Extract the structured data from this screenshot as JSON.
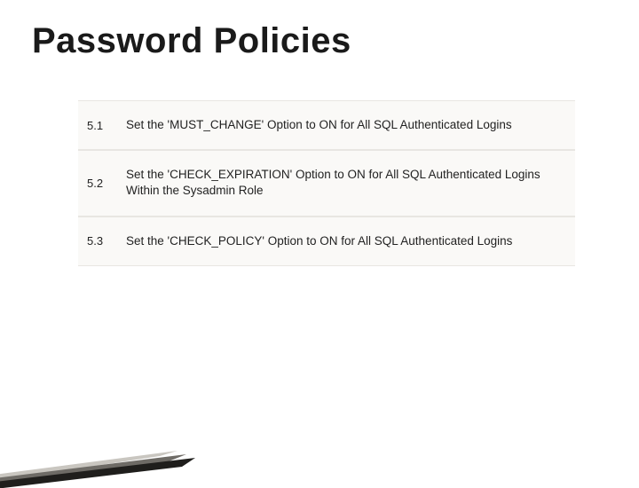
{
  "title": "Password Policies",
  "rows": [
    {
      "id": "5.1",
      "desc": "Set the 'MUST_CHANGE' Option to ON for All SQL Authenticated Logins"
    },
    {
      "id": "5.2",
      "desc": "Set the 'CHECK_EXPIRATION' Option to ON for All SQL Authenticated Logins Within the Sysadmin Role"
    },
    {
      "id": "5.3",
      "desc": "Set the 'CHECK_POLICY' Option to ON for All SQL Authenticated Logins"
    }
  ]
}
